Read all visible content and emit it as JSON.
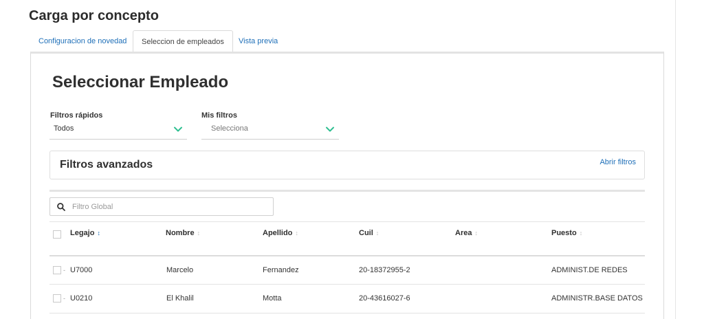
{
  "page": {
    "title": "Carga por concepto"
  },
  "tabs": [
    {
      "label": "Configuracion de novedad"
    },
    {
      "label": "Seleccion de empleados"
    },
    {
      "label": "Vista previa"
    }
  ],
  "section": {
    "title": "Seleccionar Empleado"
  },
  "filters": {
    "quick": {
      "label": "Filtros rápidos",
      "value": "Todos"
    },
    "mine": {
      "label": "Mis filtros",
      "placeholder": "Selecciona"
    }
  },
  "advanced": {
    "title": "Filtros avanzados",
    "open_link": "Abrir filtros"
  },
  "search": {
    "placeholder": "Filtro Global"
  },
  "table": {
    "columns": [
      "Legajo",
      "Nombre",
      "Apellido",
      "Cuil",
      "Area",
      "Puesto"
    ],
    "sort_icon": "↕",
    "rows": [
      {
        "legajo": "U7000",
        "nombre": "Marcelo",
        "apellido": "Fernandez",
        "cuil": "20-18372955-2",
        "area": "",
        "puesto": "ADMINIST.DE REDES"
      },
      {
        "legajo": "U0210",
        "nombre": "El Khalil",
        "apellido": "Motta",
        "cuil": "20-43616027-6",
        "area": "",
        "puesto": "ADMINISTR.BASE DATOS"
      }
    ]
  },
  "colors": {
    "link": "#1e6fb8",
    "chevron": "#2fbf91"
  }
}
